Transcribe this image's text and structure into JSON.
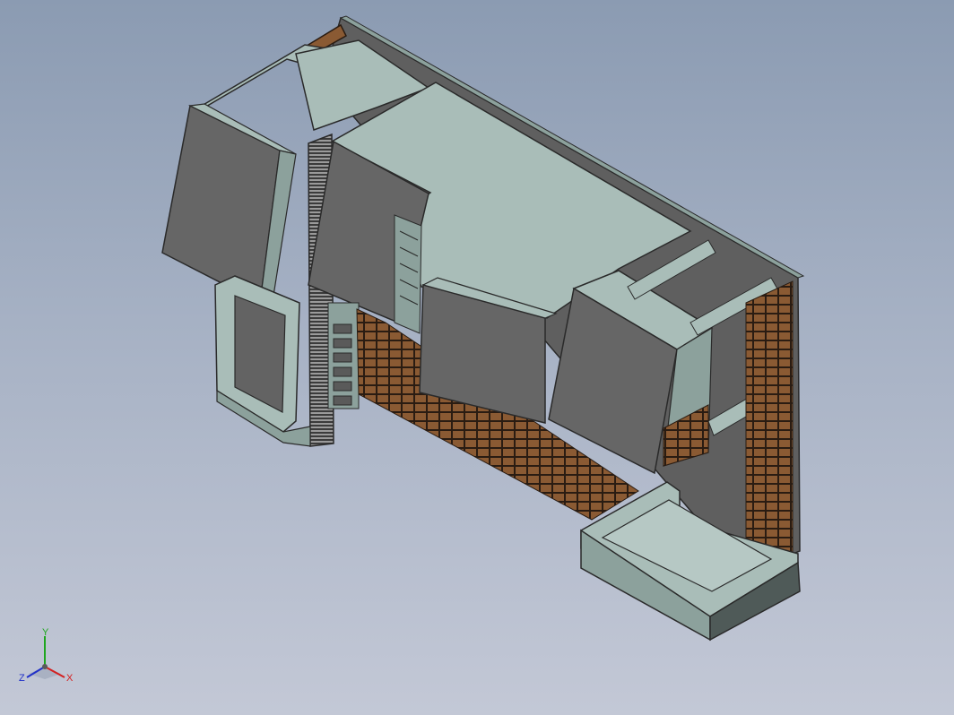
{
  "view": {
    "background_top": "#8b9bb2",
    "background_bottom": "#c3c8d6",
    "model_colors": {
      "light_face": "#a9bdb8",
      "side_face": "#8ca19c",
      "dark_face": "#636363",
      "edge": "#2a2a2a",
      "wood": "#8a5a33"
    }
  },
  "triad": {
    "x_label": "X",
    "y_label": "Y",
    "z_label": "Z",
    "x_color": "#d42020",
    "y_color": "#1fa61f",
    "z_color": "#2030c8"
  }
}
